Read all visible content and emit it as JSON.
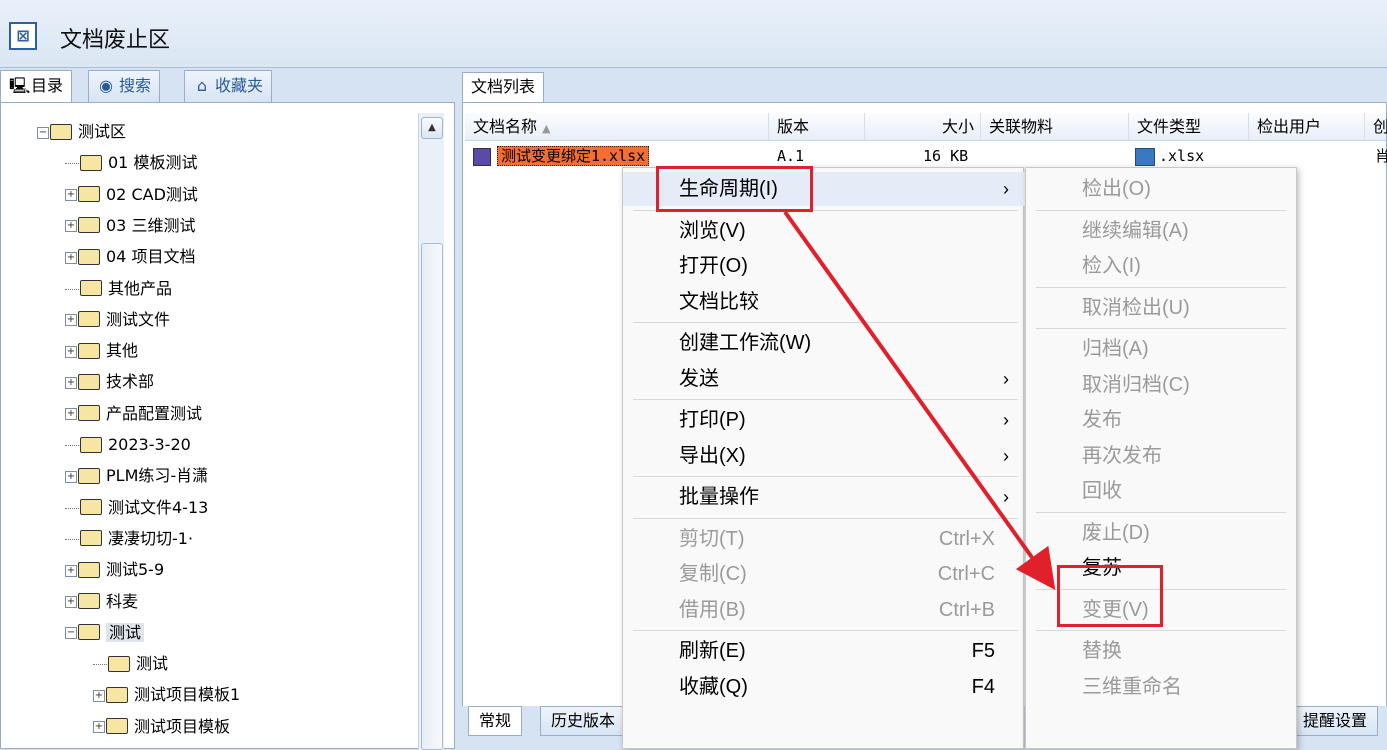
{
  "window": {
    "title": "文档废止区",
    "title_icon": "document-stop-icon"
  },
  "left_tabs": [
    {
      "label": "目录",
      "icon": "monitor-icon"
    },
    {
      "label": "搜索",
      "icon": "search-globe-icon"
    },
    {
      "label": "收藏夹",
      "icon": "favorites-icon"
    }
  ],
  "tree": [
    {
      "label": "测试区",
      "level": 0,
      "expander": "⊖"
    },
    {
      "label": "01 模板测试",
      "level": 1,
      "expander": ""
    },
    {
      "label": "02 CAD测试",
      "level": 1,
      "expander": "⊕"
    },
    {
      "label": "03 三维测试",
      "level": 1,
      "expander": "⊕"
    },
    {
      "label": "04 项目文档",
      "level": 1,
      "expander": "⊕"
    },
    {
      "label": "其他产品",
      "level": 1,
      "expander": ""
    },
    {
      "label": "测试文件",
      "level": 1,
      "expander": "⊕"
    },
    {
      "label": "其他",
      "level": 1,
      "expander": "⊕"
    },
    {
      "label": "技术部",
      "level": 1,
      "expander": "⊕"
    },
    {
      "label": "产品配置测试",
      "level": 1,
      "expander": "⊕"
    },
    {
      "label": "2023-3-20",
      "level": 1,
      "expander": ""
    },
    {
      "label": "PLM练习-肖潇",
      "level": 1,
      "expander": "⊕"
    },
    {
      "label": "测试文件4-13",
      "level": 1,
      "expander": ""
    },
    {
      "label": "凄凄切切-1·",
      "level": 1,
      "expander": ""
    },
    {
      "label": "测试5-9",
      "level": 1,
      "expander": "⊕"
    },
    {
      "label": "科麦",
      "level": 1,
      "expander": "⊕"
    },
    {
      "label": "测试",
      "level": 1,
      "expander": "⊖",
      "selected": true
    },
    {
      "label": "测试",
      "level": 2,
      "expander": ""
    },
    {
      "label": "测试项目模板1",
      "level": 2,
      "expander": "⊕"
    },
    {
      "label": "测试项目模板",
      "level": 2,
      "expander": "⊕"
    }
  ],
  "doc_list": {
    "tab_label": "文档列表",
    "columns": [
      "文档名称",
      "版本",
      "大小",
      "关联物料",
      "文件类型",
      "检出用户",
      "创"
    ],
    "rows": [
      {
        "name": "测试变更绑定1.xlsx",
        "version": "A.1",
        "size": "16 KB",
        "material": "",
        "type": ".xlsx",
        "user": "",
        "creator": "肖"
      }
    ]
  },
  "bottom_tabs": [
    "常规",
    "历史版本",
    "提醒设置"
  ],
  "context_menu": {
    "items": [
      {
        "label": "生命周期(I)",
        "arrow": "›",
        "highlight": true
      },
      {
        "sep": true
      },
      {
        "label": "浏览(V)"
      },
      {
        "label": "打开(O)"
      },
      {
        "label": "文档比较"
      },
      {
        "sep": true
      },
      {
        "label": "创建工作流(W)"
      },
      {
        "label": "发送",
        "arrow": "›"
      },
      {
        "sep": true
      },
      {
        "label": "打印(P)",
        "arrow": "›"
      },
      {
        "label": "导出(X)",
        "arrow": "›"
      },
      {
        "sep": true
      },
      {
        "label": "批量操作",
        "arrow": "›"
      },
      {
        "sep": true
      },
      {
        "label": "剪切(T)",
        "shortcut": "Ctrl+X",
        "disabled": true
      },
      {
        "label": "复制(C)",
        "shortcut": "Ctrl+C",
        "disabled": true
      },
      {
        "label": "借用(B)",
        "shortcut": "Ctrl+B",
        "disabled": true
      },
      {
        "sep": true
      },
      {
        "label": "刷新(E)",
        "shortcut": "F5"
      },
      {
        "label": "收藏(Q)",
        "shortcut": "F4"
      }
    ]
  },
  "lifecycle_submenu": {
    "items": [
      {
        "label": "检出(O)"
      },
      {
        "sep": true
      },
      {
        "label": "继续编辑(A)"
      },
      {
        "label": "检入(I)"
      },
      {
        "sep": true
      },
      {
        "label": "取消检出(U)"
      },
      {
        "sep": true
      },
      {
        "label": "归档(A)"
      },
      {
        "label": "取消归档(C)"
      },
      {
        "label": "发布"
      },
      {
        "label": "再次发布"
      },
      {
        "label": "回收"
      },
      {
        "sep": true
      },
      {
        "label": "废止(D)"
      },
      {
        "label": "复苏",
        "enabled": true
      },
      {
        "sep": true
      },
      {
        "label": "变更(V)"
      },
      {
        "sep": true
      },
      {
        "label": "替换"
      },
      {
        "label": "三维重命名"
      }
    ]
  },
  "annotation": {
    "color": "#e0202a"
  }
}
